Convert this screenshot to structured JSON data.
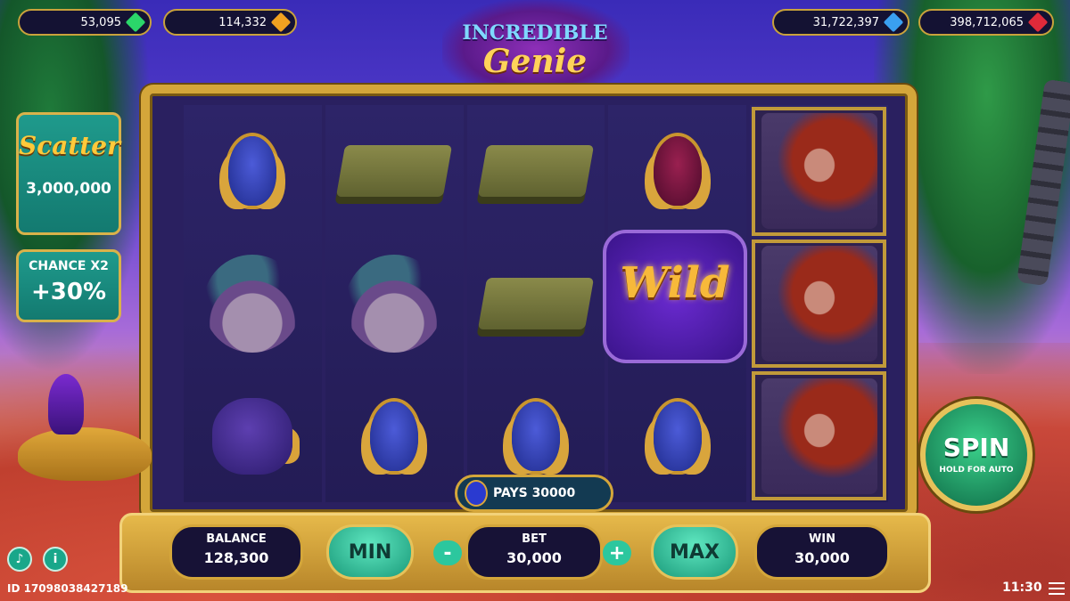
{
  "jackpots": [
    {
      "value": "53,095",
      "color": "#2bd66a",
      "icon": "green-gem-icon"
    },
    {
      "value": "114,332",
      "color": "#f0a020",
      "icon": "orange-gem-icon"
    },
    {
      "value": "31,722,397",
      "color": "#3aa0f0",
      "icon": "blue-gem-icon"
    },
    {
      "value": "398,712,065",
      "color": "#e02a3a",
      "icon": "red-gem-icon"
    }
  ],
  "logo": {
    "line1": "INCREDIBLE",
    "line2": "Genie"
  },
  "scatter": {
    "title": "Scatter",
    "value": "3,000,000"
  },
  "chance": {
    "title": "CHANCE X2",
    "value": "+30%"
  },
  "reels": [
    [
      "blue-crest",
      "turban",
      "pot-of-gold"
    ],
    [
      "book",
      "turban",
      "blue-crest"
    ],
    [
      "book",
      "book",
      "blue-crest"
    ],
    [
      "red-crest",
      "wild",
      "blue-crest"
    ],
    [
      "woman",
      "woman",
      "woman"
    ]
  ],
  "wild_label": "Wild",
  "pays": {
    "label": "PAYS 30000"
  },
  "controls": {
    "balance_label": "BALANCE",
    "balance_value": "128,300",
    "min_label": "MIN",
    "minus": "-",
    "bet_label": "BET",
    "bet_value": "30,000",
    "plus": "+",
    "max_label": "MAX",
    "win_label": "WIN",
    "win_value": "30,000"
  },
  "spin": {
    "label": "SPIN",
    "sub": "HOLD FOR AUTO"
  },
  "footer": {
    "id": "ID 17098038427189",
    "clock": "11:30"
  },
  "icons": {
    "sound": "speaker-icon",
    "info": "info-icon",
    "menu": "menu-icon"
  }
}
